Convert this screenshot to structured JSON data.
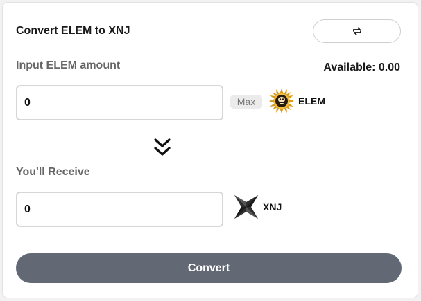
{
  "header": {
    "title": "Convert ELEM to XNJ",
    "swap_icon": "swap-arrows-icon"
  },
  "input_section": {
    "label": "Input ELEM amount",
    "available": "Available: 0.00",
    "value": "0",
    "max_label": "Max",
    "token": "ELEM",
    "token_icon": "elem-logo"
  },
  "arrow_icon": "chevron-double-down-icon",
  "output_section": {
    "label": "You'll Receive",
    "value": "0",
    "token": "XNJ",
    "token_icon": "xnj-logo"
  },
  "convert_button": "Convert",
  "colors": {
    "button_bg": "#636875",
    "label_gray": "#666666",
    "elem_gold": "#e0a020"
  }
}
